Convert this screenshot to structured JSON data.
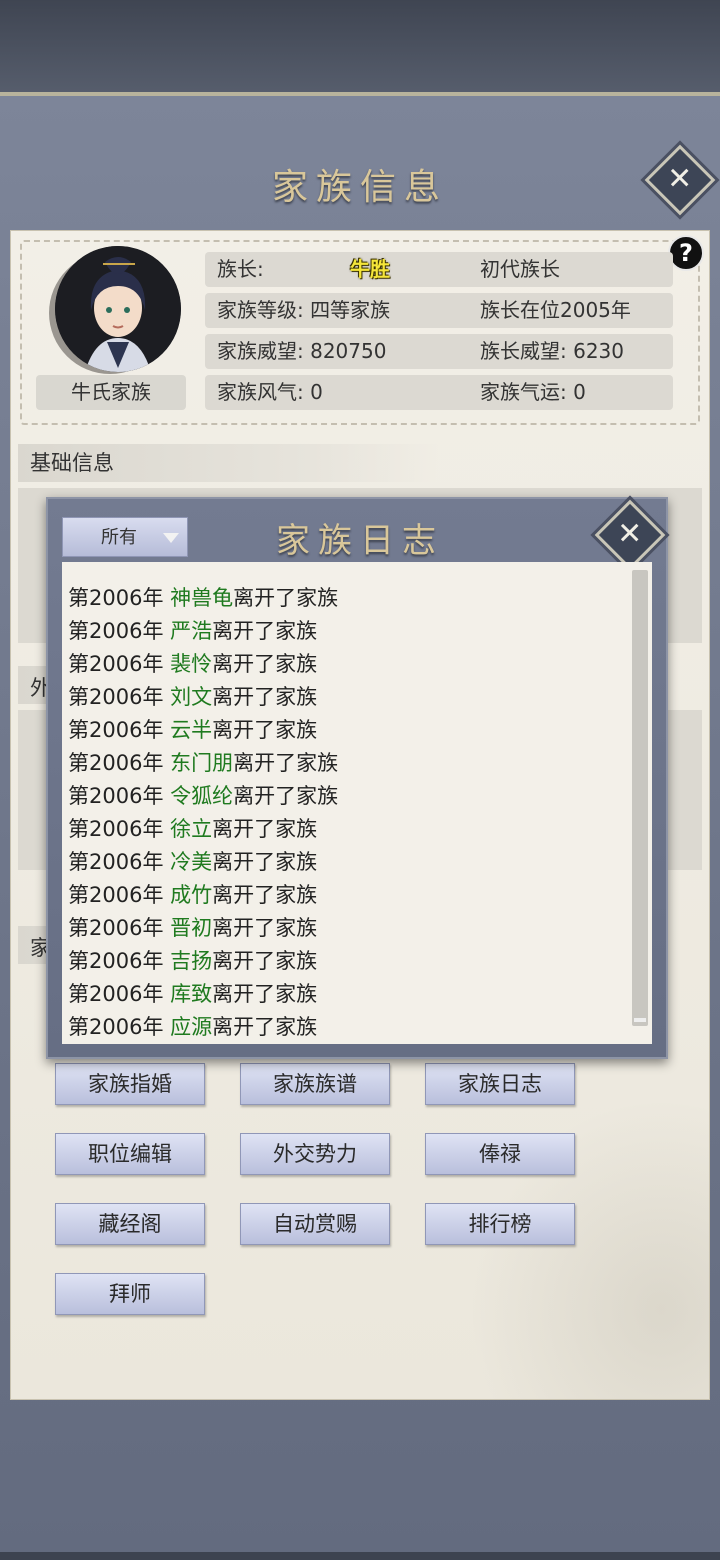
{
  "title": "家族信息",
  "profile": {
    "family_name": "牛氏家族",
    "rows": [
      {
        "label": "族长:",
        "value": "牛胜",
        "extra": "初代族长"
      },
      {
        "left": "家族等级: 四等家族",
        "right": "族长在位2005年"
      },
      {
        "left": "家族威望: 820750",
        "right": "族长威望: 6230"
      },
      {
        "left": "家族风气: 0",
        "right": "家族气运: 0"
      }
    ]
  },
  "sections": {
    "basic": "基础信息",
    "peek_2": "外",
    "peek_3": "家"
  },
  "log_modal": {
    "title": "家族日志",
    "filter_value": "所有",
    "entries": [
      {
        "year": "第2006年",
        "name": "神兽龟",
        "action": "离开了家族"
      },
      {
        "year": "第2006年",
        "name": "严浩",
        "action": "离开了家族"
      },
      {
        "year": "第2006年",
        "name": "裴怜",
        "action": "离开了家族"
      },
      {
        "year": "第2006年",
        "name": "刘文",
        "action": "离开了家族"
      },
      {
        "year": "第2006年",
        "name": "云半",
        "action": "离开了家族"
      },
      {
        "year": "第2006年",
        "name": "东门朋",
        "action": "离开了家族"
      },
      {
        "year": "第2006年",
        "name": "令狐纶",
        "action": "离开了家族"
      },
      {
        "year": "第2006年",
        "name": "徐立",
        "action": "离开了家族"
      },
      {
        "year": "第2006年",
        "name": "冷美",
        "action": "离开了家族"
      },
      {
        "year": "第2006年",
        "name": "成竹",
        "action": "离开了家族"
      },
      {
        "year": "第2006年",
        "name": "晋初",
        "action": "离开了家族"
      },
      {
        "year": "第2006年",
        "name": "吉扬",
        "action": "离开了家族"
      },
      {
        "year": "第2006年",
        "name": "库致",
        "action": "离开了家族"
      },
      {
        "year": "第2006年",
        "name": "应源",
        "action": "离开了家族"
      }
    ]
  },
  "buttons": [
    "家族指婚",
    "家族族谱",
    "家族日志",
    "职位编辑",
    "外交势力",
    "俸禄",
    "藏经阁",
    "自动赏赐",
    "排行榜",
    "拜师"
  ],
  "icons": {
    "close": "close-icon",
    "help": "question-mark-icon",
    "dropdown": "dropdown-arrow-icon"
  },
  "colors": {
    "title_gold": "#d9c79a",
    "leader_name": "#f5e63a",
    "log_name_green": "#1f7a1f"
  }
}
